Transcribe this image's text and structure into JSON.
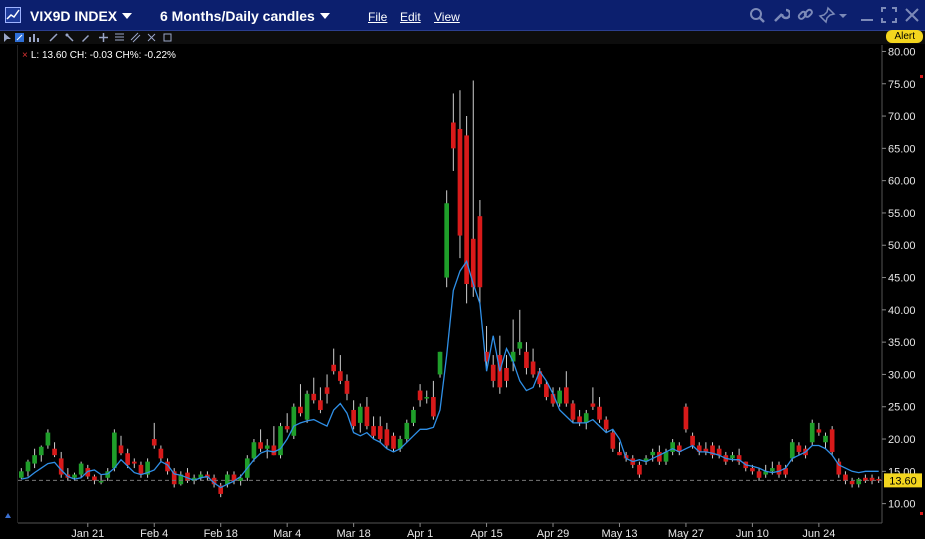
{
  "window": {
    "symbol": "VIX9D INDEX",
    "timeframe": "6 Months/Daily candles",
    "menus": [
      "File",
      "Edit",
      "View"
    ],
    "alert_label": "Alert"
  },
  "legend": {
    "text": "L: 13.60  CH: -0.03  CH%: -0.22%"
  },
  "colors": {
    "up": "#1f9e2a",
    "down": "#d81a1a",
    "line": "#2f8fe6",
    "last_price_bg": "#f3d51e",
    "titlebar": "#0c1f6e"
  },
  "chart_data": {
    "type": "candlestick",
    "xlabels": [
      "Jan 21",
      "Feb 4",
      "Feb 18",
      "Mar 4",
      "Mar 18",
      "Apr 1",
      "Apr 15",
      "Apr 29",
      "May 13",
      "May 27",
      "Jun 10",
      "Jun 24"
    ],
    "xlabel_index": [
      10,
      20,
      30,
      40,
      50,
      60,
      70,
      80,
      90,
      100,
      110,
      120
    ],
    "yticks": [
      10,
      15,
      20,
      25,
      30,
      35,
      40,
      45,
      50,
      55,
      60,
      65,
      70,
      75,
      80
    ],
    "ylim": [
      7,
      81
    ],
    "last_price": "13.60",
    "candles": [
      [
        14.0,
        15.5,
        13.8,
        15.0
      ],
      [
        15.0,
        16.8,
        14.2,
        16.5
      ],
      [
        16.2,
        18.5,
        15.5,
        17.5
      ],
      [
        17.5,
        19.0,
        16.5,
        18.8
      ],
      [
        19.0,
        21.5,
        18.5,
        21.0
      ],
      [
        18.5,
        19.5,
        17.2,
        17.5
      ],
      [
        17.0,
        18.0,
        14.0,
        14.5
      ],
      [
        14.5,
        15.5,
        13.5,
        14.0
      ],
      [
        14.0,
        14.8,
        13.5,
        14.5
      ],
      [
        14.5,
        16.5,
        14.0,
        16.2
      ],
      [
        15.5,
        16.0,
        13.8,
        14.2
      ],
      [
        14.2,
        14.5,
        13.0,
        13.6
      ],
      [
        13.5,
        14.5,
        13.0,
        13.5
      ],
      [
        14.0,
        15.5,
        13.5,
        15.0
      ],
      [
        15.5,
        21.5,
        15.0,
        21.0
      ],
      [
        19.0,
        20.5,
        17.5,
        17.8
      ],
      [
        17.8,
        18.5,
        15.5,
        16.0
      ],
      [
        16.5,
        17.0,
        15.5,
        16.2
      ],
      [
        16.0,
        16.5,
        14.0,
        14.5
      ],
      [
        14.5,
        17.0,
        14.0,
        16.5
      ],
      [
        20.0,
        22.5,
        18.5,
        19.0
      ],
      [
        18.5,
        19.0,
        16.5,
        17.0
      ],
      [
        16.5,
        17.0,
        14.5,
        15.0
      ],
      [
        15.0,
        15.5,
        12.5,
        13.0
      ],
      [
        13.0,
        15.0,
        12.8,
        14.5
      ],
      [
        14.8,
        15.5,
        13.2,
        13.5
      ],
      [
        13.5,
        14.5,
        13.0,
        14.0
      ],
      [
        14.0,
        15.0,
        13.5,
        14.5
      ],
      [
        14.5,
        15.0,
        13.5,
        14.0
      ],
      [
        14.0,
        14.5,
        12.5,
        13.0
      ],
      [
        12.8,
        13.2,
        11.0,
        11.5
      ],
      [
        13.0,
        15.0,
        12.5,
        14.5
      ],
      [
        14.5,
        15.0,
        13.0,
        13.5
      ],
      [
        13.5,
        14.5,
        12.8,
        14.0
      ],
      [
        14.0,
        17.5,
        13.5,
        17.0
      ],
      [
        17.0,
        20.0,
        16.5,
        19.5
      ],
      [
        19.5,
        21.5,
        18.0,
        18.5
      ],
      [
        18.5,
        20.0,
        17.0,
        19.0
      ],
      [
        19.0,
        22.0,
        17.5,
        17.5
      ],
      [
        17.5,
        22.5,
        17.0,
        22.0
      ],
      [
        22.0,
        24.0,
        21.0,
        21.5
      ],
      [
        20.5,
        25.5,
        20.0,
        25.0
      ],
      [
        25.0,
        28.5,
        23.5,
        24.0
      ],
      [
        23.0,
        27.5,
        22.5,
        27.0
      ],
      [
        27.0,
        29.5,
        25.5,
        26.0
      ],
      [
        26.0,
        28.0,
        24.0,
        24.5
      ],
      [
        28.0,
        30.0,
        25.5,
        27.0
      ],
      [
        31.5,
        34.0,
        30.0,
        30.5
      ],
      [
        30.5,
        33.0,
        28.5,
        29.0
      ],
      [
        29.0,
        30.0,
        26.0,
        27.0
      ],
      [
        24.5,
        26.0,
        21.5,
        22.0
      ],
      [
        22.5,
        25.5,
        21.0,
        25.0
      ],
      [
        25.0,
        26.5,
        21.5,
        22.0
      ],
      [
        22.0,
        23.5,
        20.0,
        20.5
      ],
      [
        22.0,
        23.5,
        19.5,
        20.0
      ],
      [
        21.5,
        22.5,
        18.5,
        19.0
      ],
      [
        20.5,
        21.0,
        18.0,
        18.5
      ],
      [
        18.5,
        20.5,
        18.0,
        20.0
      ],
      [
        20.0,
        23.0,
        19.5,
        22.5
      ],
      [
        22.5,
        25.0,
        22.0,
        24.5
      ],
      [
        27.5,
        28.5,
        25.0,
        26.0
      ],
      [
        26.5,
        27.5,
        25.5,
        26.5
      ],
      [
        26.5,
        29.0,
        23.0,
        23.5
      ],
      [
        30.0,
        33.5,
        29.5,
        33.5
      ],
      [
        45.0,
        58.5,
        43.5,
        56.5
      ],
      [
        69.0,
        73.5,
        61.5,
        65.0
      ],
      [
        68.0,
        74.0,
        48.0,
        51.5
      ],
      [
        67.0,
        70.0,
        41.0,
        44.0
      ],
      [
        51.0,
        75.5,
        42.0,
        43.5
      ],
      [
        54.5,
        57.0,
        41.0,
        43.5
      ],
      [
        33.5,
        37.5,
        31.0,
        32.0
      ],
      [
        31.5,
        33.0,
        28.0,
        29.0
      ],
      [
        33.0,
        36.0,
        27.0,
        28.0
      ],
      [
        31.0,
        33.0,
        28.0,
        29.0
      ],
      [
        32.0,
        38.5,
        30.5,
        33.5
      ],
      [
        34.0,
        40.0,
        33.0,
        35.0
      ],
      [
        33.5,
        35.0,
        30.0,
        31.0
      ],
      [
        32.0,
        34.0,
        29.5,
        30.0
      ],
      [
        30.5,
        31.0,
        28.0,
        28.5
      ],
      [
        28.5,
        29.0,
        26.0,
        26.5
      ],
      [
        27.0,
        28.0,
        25.0,
        25.5
      ],
      [
        25.5,
        28.0,
        25.0,
        27.5
      ],
      [
        28.0,
        30.5,
        25.0,
        25.5
      ],
      [
        25.5,
        26.0,
        22.5,
        23.0
      ],
      [
        23.5,
        24.5,
        22.0,
        22.5
      ],
      [
        22.5,
        24.5,
        21.5,
        24.0
      ],
      [
        25.5,
        28.0,
        24.5,
        25.0
      ],
      [
        25.0,
        26.5,
        22.5,
        23.0
      ],
      [
        23.0,
        23.5,
        21.0,
        21.5
      ],
      [
        21.0,
        21.5,
        18.0,
        18.5
      ],
      [
        18.0,
        19.5,
        17.5,
        17.5
      ],
      [
        17.5,
        18.0,
        16.5,
        17.0
      ],
      [
        17.0,
        17.5,
        15.5,
        16.0
      ],
      [
        16.0,
        16.5,
        14.0,
        14.5
      ],
      [
        16.5,
        17.5,
        16.0,
        17.0
      ],
      [
        17.5,
        18.5,
        16.5,
        18.0
      ],
      [
        18.0,
        19.0,
        16.0,
        16.5
      ],
      [
        16.5,
        18.5,
        16.0,
        18.0
      ],
      [
        18.0,
        20.0,
        17.5,
        19.5
      ],
      [
        19.0,
        19.5,
        17.5,
        18.0
      ],
      [
        25.0,
        25.5,
        21.0,
        21.5
      ],
      [
        20.5,
        21.0,
        18.5,
        19.0
      ],
      [
        19.0,
        19.5,
        17.5,
        18.0
      ],
      [
        18.5,
        19.5,
        17.5,
        18.0
      ],
      [
        19.0,
        19.5,
        17.0,
        17.5
      ],
      [
        18.5,
        19.0,
        17.0,
        17.5
      ],
      [
        17.5,
        18.0,
        16.0,
        16.5
      ],
      [
        17.0,
        18.0,
        16.5,
        17.5
      ],
      [
        17.5,
        18.5,
        16.0,
        16.5
      ],
      [
        16.5,
        16.5,
        15.0,
        15.5
      ],
      [
        15.5,
        16.0,
        14.5,
        15.0
      ],
      [
        15.0,
        15.5,
        13.5,
        14.0
      ],
      [
        14.5,
        16.0,
        14.0,
        15.0
      ],
      [
        15.0,
        16.5,
        14.5,
        15.5
      ],
      [
        16.0,
        16.5,
        14.0,
        14.5
      ],
      [
        15.5,
        16.0,
        14.0,
        14.5
      ],
      [
        17.0,
        20.0,
        16.5,
        19.5
      ],
      [
        19.0,
        19.5,
        17.5,
        18.0
      ],
      [
        18.5,
        19.0,
        17.0,
        17.5
      ],
      [
        19.5,
        23.0,
        19.0,
        22.5
      ],
      [
        21.5,
        22.5,
        20.5,
        21.0
      ],
      [
        19.5,
        21.0,
        18.5,
        20.5
      ],
      [
        21.5,
        22.0,
        17.5,
        18.0
      ],
      [
        16.5,
        17.0,
        14.0,
        14.5
      ],
      [
        14.5,
        15.0,
        13.0,
        13.5
      ],
      [
        13.5,
        14.0,
        12.5,
        13.0
      ],
      [
        13.0,
        14.0,
        12.5,
        13.8
      ],
      [
        14.0,
        14.5,
        13.2,
        13.5
      ],
      [
        14.0,
        14.5,
        13.0,
        13.5
      ],
      [
        13.8,
        14.2,
        13.2,
        13.6
      ]
    ],
    "line": [
      13.8,
      14.0,
      14.8,
      15.5,
      16.2,
      16.4,
      15.2,
      14.2,
      13.8,
      14.0,
      15.0,
      15.2,
      14.5,
      14.6,
      15.5,
      16.8,
      15.8,
      14.8,
      14.5,
      14.8,
      15.2,
      16.5,
      16.0,
      14.6,
      14.4,
      14.0,
      13.6,
      14.0,
      14.2,
      13.2,
      12.5,
      13.0,
      13.5,
      14.2,
      15.5,
      16.8,
      17.8,
      18.2,
      18.0,
      18.5,
      20.0,
      22.0,
      22.5,
      22.8,
      23.0,
      22.5,
      22.0,
      24.5,
      25.5,
      24.0,
      21.0,
      20.5,
      21.0,
      20.0,
      19.5,
      18.5,
      18.0,
      18.5,
      19.5,
      20.5,
      21.5,
      21.5,
      21.8,
      24.5,
      33.0,
      43.0,
      46.0,
      47.5,
      44.0,
      41.0,
      30.5,
      36.0,
      30.5,
      34.0,
      32.0,
      29.0,
      27.5,
      28.0,
      30.5,
      29.0,
      27.0,
      24.5,
      23.5,
      22.5,
      22.5,
      22.5,
      23.0,
      22.0,
      21.0,
      21.5,
      20.0,
      17.0,
      16.5,
      16.8,
      16.5,
      17.0,
      17.5,
      18.0,
      18.5,
      18.0,
      18.5,
      19.0,
      18.0,
      18.0,
      17.8,
      17.5,
      17.0,
      16.8,
      16.8,
      16.0,
      15.8,
      15.5,
      15.0,
      14.8,
      15.0,
      15.5,
      17.0,
      17.5,
      18.0,
      19.0,
      19.0,
      18.5,
      17.5,
      16.0,
      15.5,
      15.0,
      14.8,
      15.0,
      15.0,
      15.0
    ]
  }
}
